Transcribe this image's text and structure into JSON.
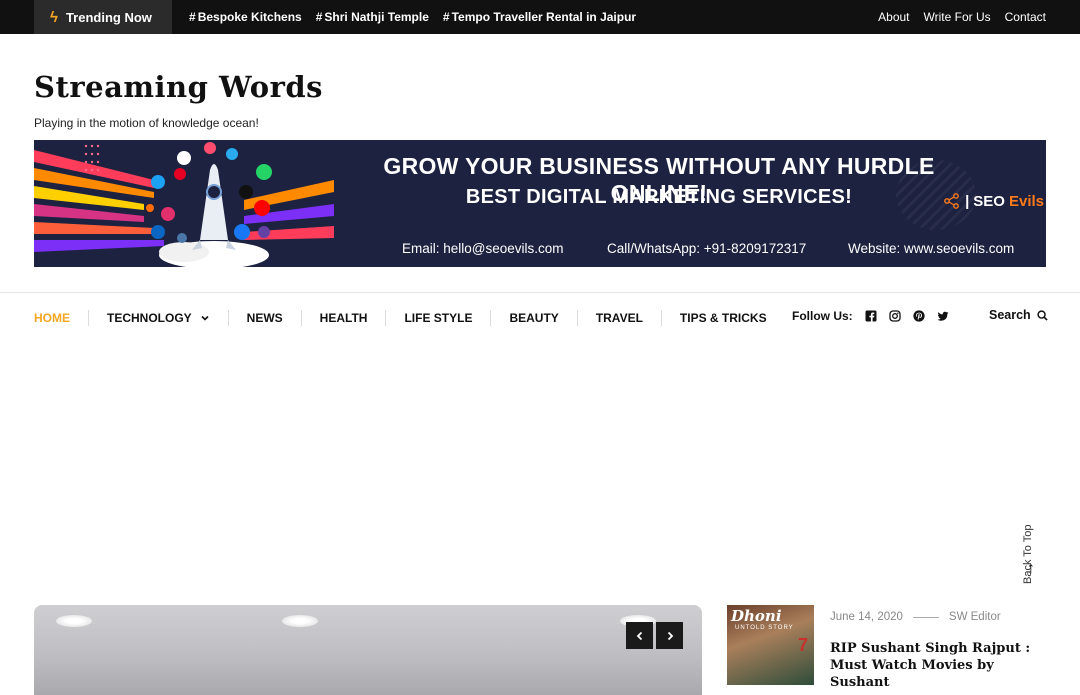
{
  "topbar": {
    "trending_label": "Trending Now",
    "tags": [
      "Bespoke Kitchens",
      "Shri Nathji Temple",
      "Tempo Traveller Rental in Jaipur"
    ],
    "links": [
      "About",
      "Write For Us",
      "Contact"
    ]
  },
  "header": {
    "title": "Streaming Words",
    "tagline": "Playing in the motion of knowledge ocean!"
  },
  "banner": {
    "headline": "GROW YOUR BUSINESS WITHOUT ANY HURDLE ONLINE!",
    "subheadline": "BEST DIGITAL MARKETING SERVICES!",
    "email": "Email: hello@seoevils.com",
    "phone": "Call/WhatsApp: +91-8209172317",
    "website": "Website: www.seoevils.com",
    "logo_seo": "SEO",
    "logo_evils": "Evils"
  },
  "nav": {
    "items": [
      "HOME",
      "TECHNOLOGY",
      "NEWS",
      "HEALTH",
      "LIFE STYLE",
      "BEAUTY",
      "TRAVEL",
      "TIPS & TRICKS"
    ],
    "active_index": 0,
    "follow_label": "Follow Us:",
    "search_label": "Search"
  },
  "post": {
    "thumb_title": "Dhoni",
    "thumb_subtitle": "UNTOLD STORY",
    "thumb_number": "7",
    "date": "June 14, 2020",
    "author": "SW Editor",
    "title": "RIP Sushant Singh Rajput : Must Watch Movies by Sushant"
  },
  "back_to_top": "Back To Top",
  "colors": {
    "accent": "#f5a623",
    "topbar": "#111111",
    "banner_bg": "#1d2240"
  }
}
